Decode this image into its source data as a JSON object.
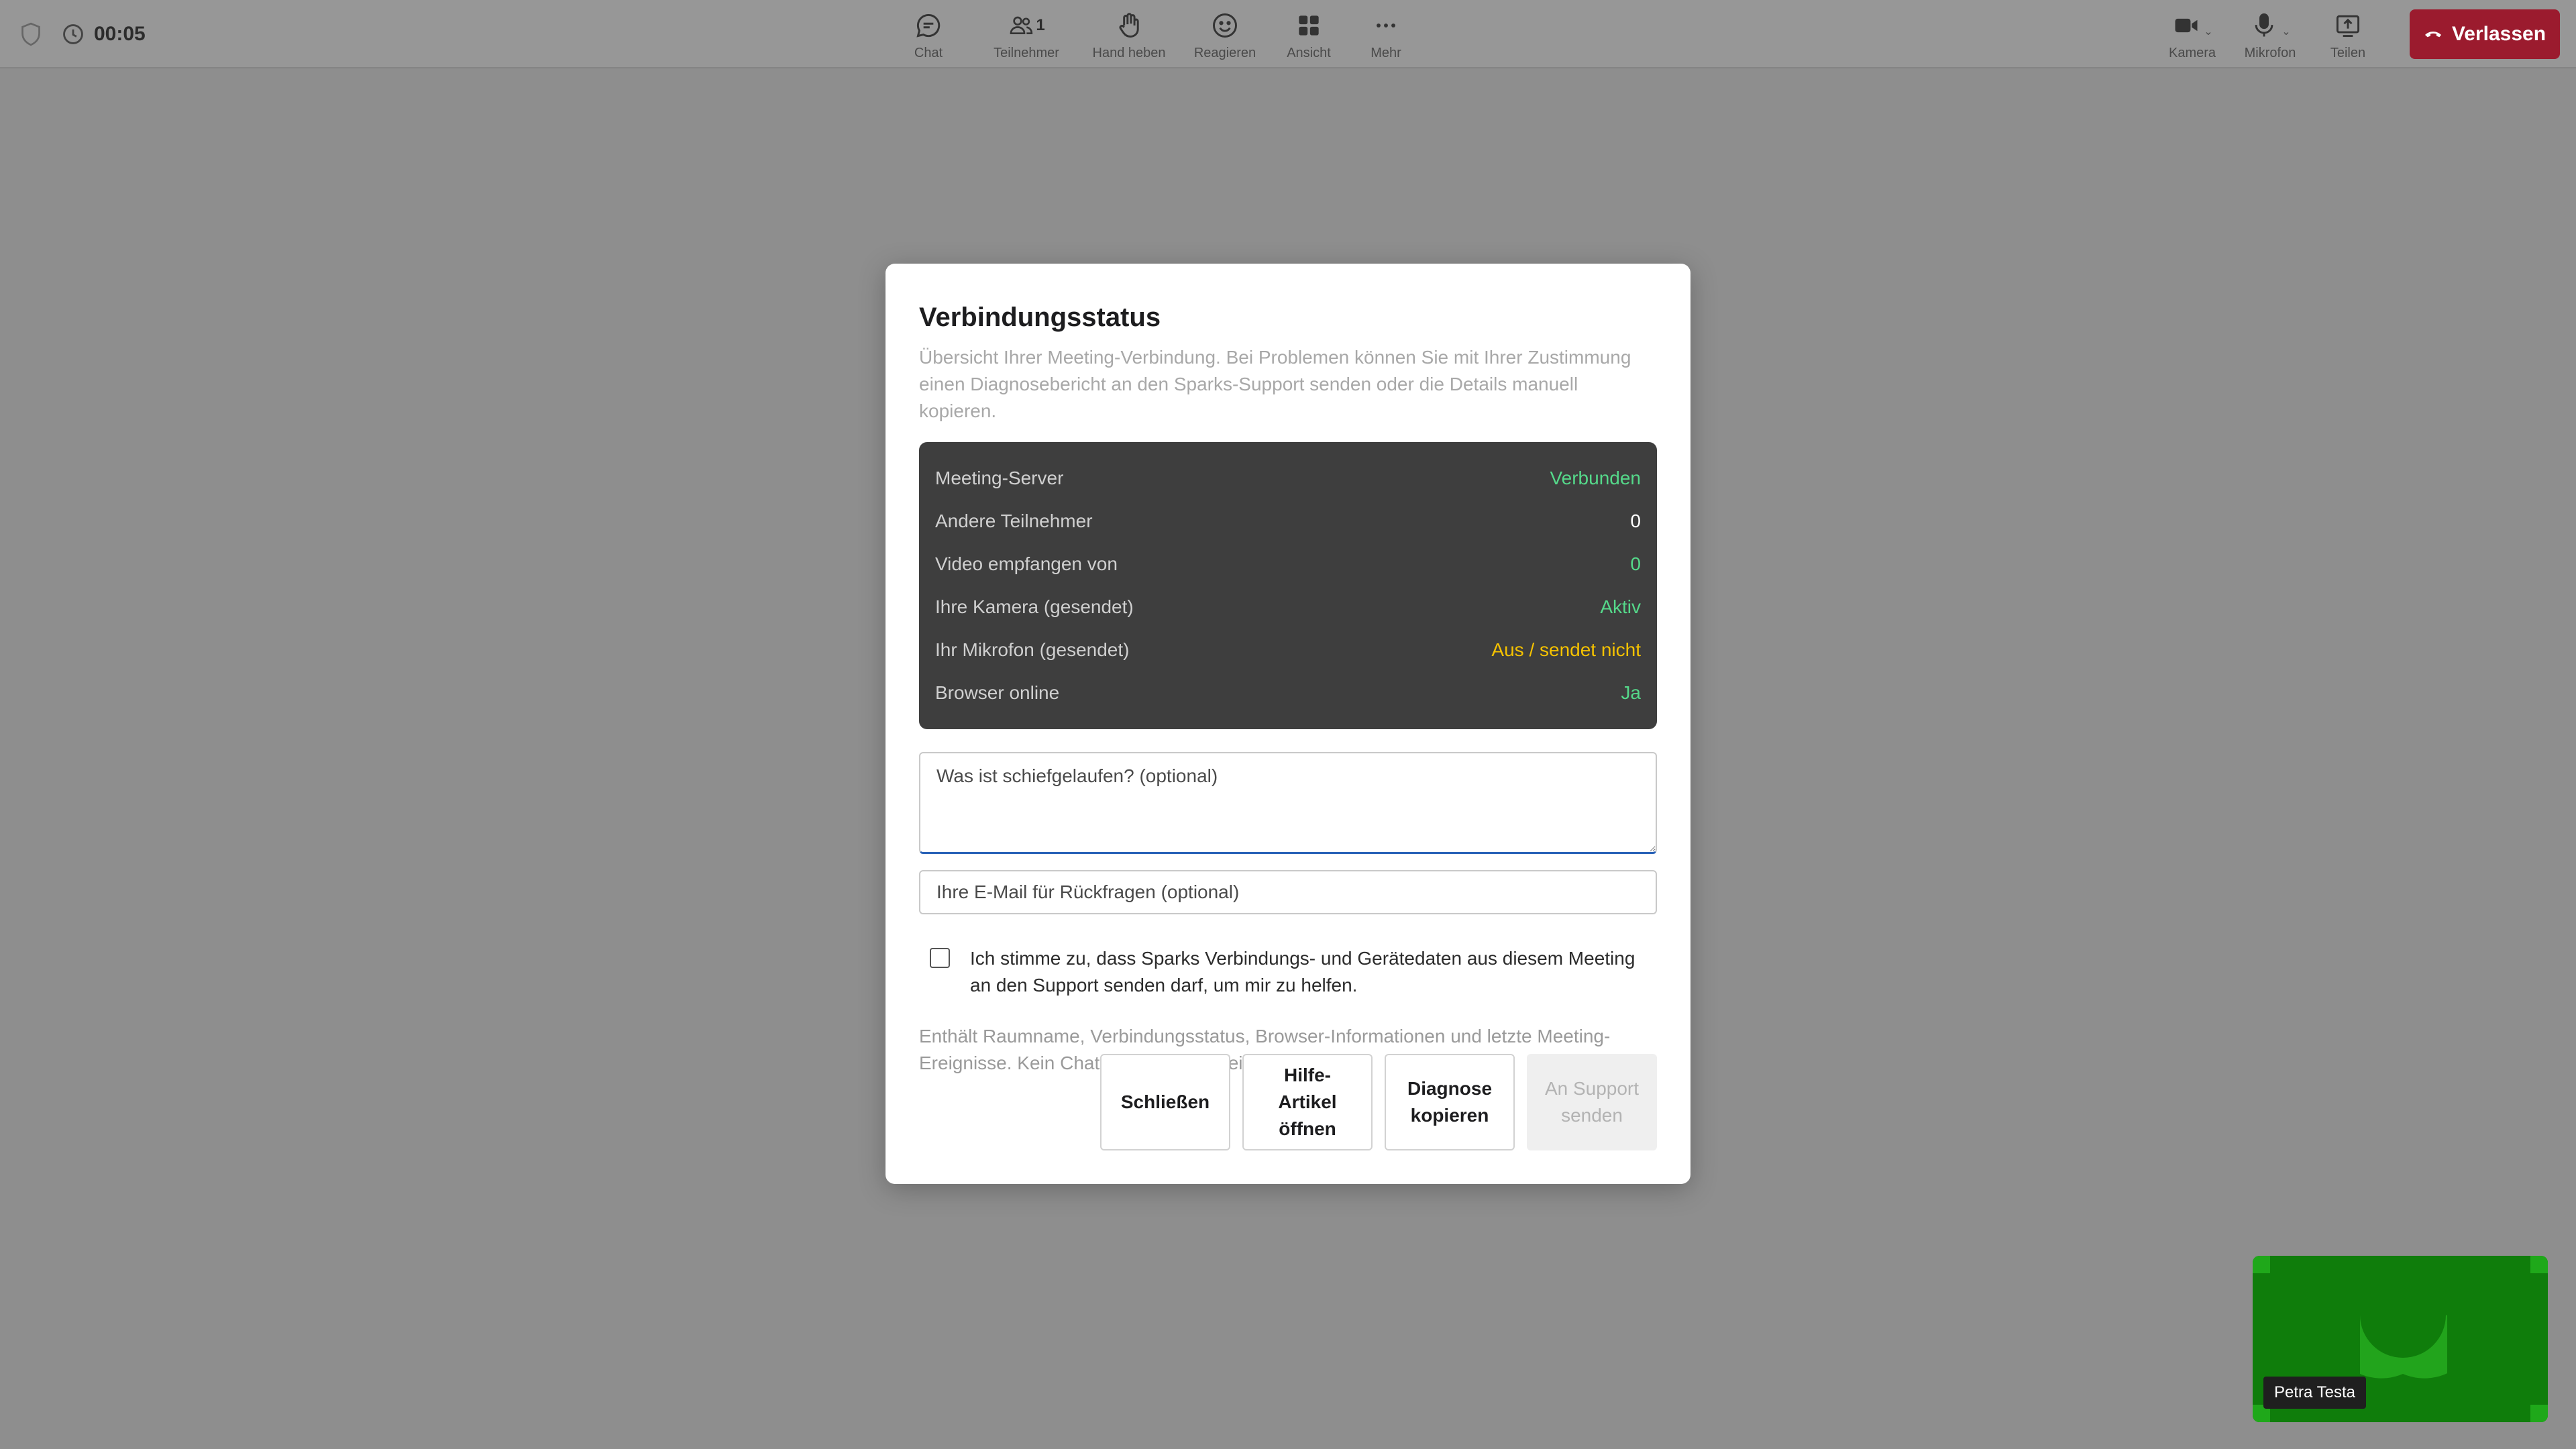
{
  "topbar": {
    "timer": "00:05",
    "center_buttons": [
      {
        "id": "chat",
        "label": "Chat",
        "icon": "chat-bubble-icon"
      },
      {
        "id": "participants",
        "label": "Teilnehmer",
        "icon": "people-icon",
        "count": "1"
      },
      {
        "id": "raise-hand",
        "label": "Hand heben",
        "icon": "hand-icon"
      },
      {
        "id": "react",
        "label": "Reagieren",
        "icon": "smiley-icon"
      },
      {
        "id": "view",
        "label": "Ansicht",
        "icon": "grid-icon"
      },
      {
        "id": "more",
        "label": "Mehr",
        "icon": "ellipsis-icon"
      }
    ],
    "right_buttons": [
      {
        "id": "camera",
        "label": "Kamera",
        "icon": "camera-icon"
      },
      {
        "id": "microphone",
        "label": "Mikrofon",
        "icon": "microphone-icon"
      },
      {
        "id": "share",
        "label": "Teilen",
        "icon": "share-screen-icon"
      }
    ],
    "leave_label": "Verlassen"
  },
  "dialog": {
    "title": "Verbindungsstatus",
    "description": "Übersicht Ihrer Meeting-Verbindung. Bei Problemen können Sie mit Ihrer Zustimmung einen Diagnosebericht an den Sparks-Support senden oder die Details manuell kopieren.",
    "status": [
      {
        "label": "Meeting-Server",
        "value": "Verbunden",
        "tone": "green"
      },
      {
        "label": "Andere Teilnehmer",
        "value": "0",
        "tone": "white"
      },
      {
        "label": "Video empfangen von",
        "value": "0",
        "tone": "green"
      },
      {
        "label": "Ihre Kamera (gesendet)",
        "value": "Aktiv",
        "tone": "green"
      },
      {
        "label": "Ihr Mikrofon (gesendet)",
        "value": "Aus / sendet nicht",
        "tone": "yellow"
      },
      {
        "label": "Browser online",
        "value": "Ja",
        "tone": "green"
      }
    ],
    "problem_placeholder": "Was ist schiefgelaufen? (optional)",
    "email_placeholder": "Ihre E-Mail für Rückfragen (optional)",
    "consent_text": "Ich stimme zu, dass Sparks Verbindungs- und Gerätedaten aus diesem Meeting an den Support senden darf, um mir zu helfen.",
    "note": "Enthält Raumname, Verbindungsstatus, Browser-Informationen und letzte Meeting-Ereignisse. Kein Chat- oder Aufnahmeinhalt.",
    "buttons": {
      "close": "Schließen",
      "help": "Hilfe-Artikel öffnen",
      "copy": "Diagnose kopieren",
      "send": "An Support senden"
    }
  },
  "selfview": {
    "name": "Petra Testa"
  },
  "colors": {
    "leave": "#9b1b2e",
    "status_green": "#55d98a",
    "status_yellow": "#f5c200",
    "selfview_bg": "#0f7d0b"
  }
}
